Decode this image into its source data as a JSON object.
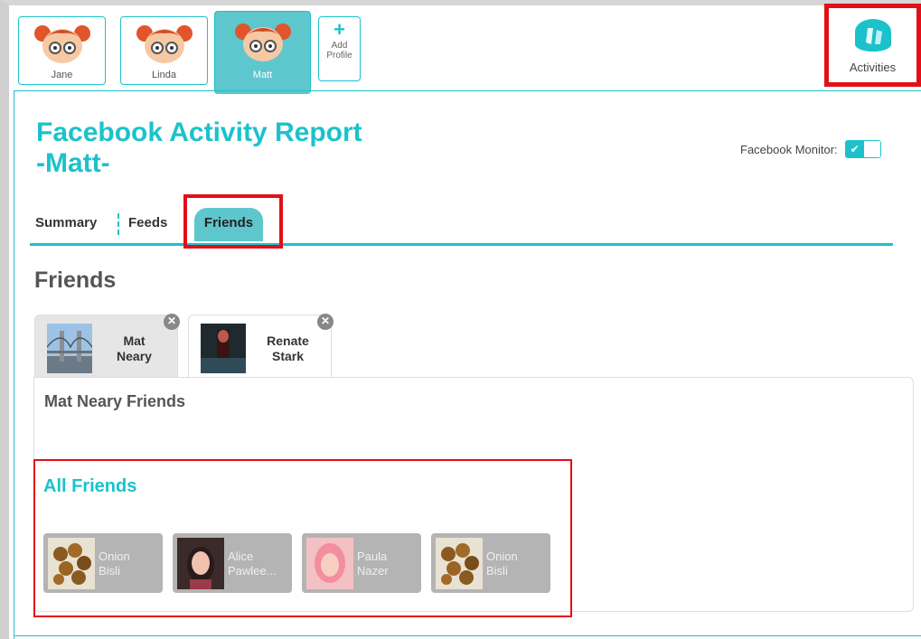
{
  "profiles": [
    {
      "name": "Jane",
      "active": false
    },
    {
      "name": "Linda",
      "active": false
    },
    {
      "name": "Matt",
      "active": true
    }
  ],
  "add_profile": {
    "icon": "plus-icon",
    "label_line1": "Add",
    "label_line2": "Profile"
  },
  "activities": {
    "label": "Activities",
    "icon": "activities-icon"
  },
  "report": {
    "title_line1": "Facebook Activity Report",
    "title_line2": "-Matt-"
  },
  "monitor": {
    "label": "Facebook Monitor:",
    "checkmark": "✔",
    "enabled": true
  },
  "tabs": {
    "summary": "Summary",
    "feeds": "Feeds",
    "friends": "Friends",
    "active": "friends"
  },
  "section_heading": "Friends",
  "people": [
    {
      "first": "Mat",
      "last": "Neary",
      "selected": true
    },
    {
      "first": "Renate",
      "last": "Stark",
      "selected": false
    }
  ],
  "close_glyph": "✕",
  "panel_title": "Mat Neary Friends",
  "all_friends": {
    "title": "All Friends",
    "items": [
      {
        "first": "Onion",
        "last": "Bisli",
        "photo": "food"
      },
      {
        "first": "Alice",
        "last": "Pawlee...",
        "photo": "woman-dark-hair"
      },
      {
        "first": "Paula",
        "last": "Nazer",
        "photo": "woman-pink-hair"
      },
      {
        "first": "Onion",
        "last": "Bisli",
        "photo": "food"
      }
    ]
  },
  "colors": {
    "accent": "#1cc2cb",
    "active_tab": "#5ec6cd",
    "highlight": "#e30f17",
    "card": "#b4b4b4"
  }
}
